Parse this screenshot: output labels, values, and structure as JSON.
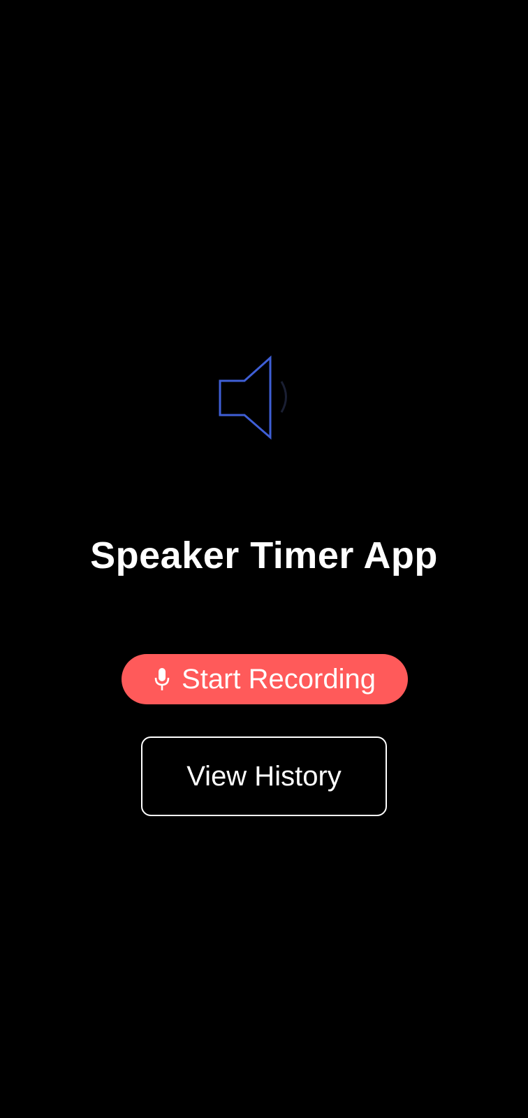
{
  "app": {
    "title": "Speaker Timer App"
  },
  "hero": {
    "icon": "speaker-icon",
    "icon_color": "#3f5fd6"
  },
  "actions": {
    "start_recording": {
      "label": "Start Recording",
      "icon": "mic-icon",
      "color": "#ff5a5a"
    },
    "view_history": {
      "label": "View History"
    }
  },
  "colors": {
    "background": "#000000",
    "text": "#ffffff"
  }
}
